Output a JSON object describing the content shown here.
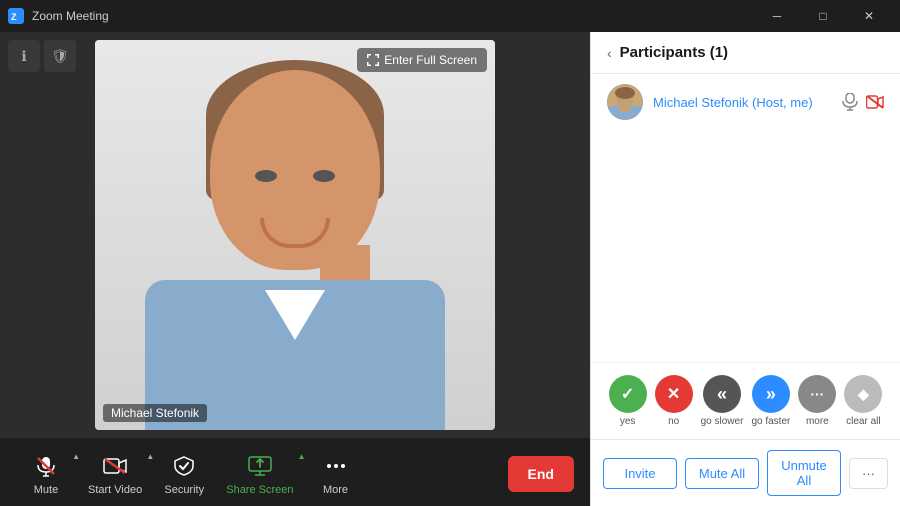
{
  "titleBar": {
    "appName": "Zoom Meeting",
    "minimizeIcon": "─",
    "maximizeIcon": "□",
    "closeIcon": "✕"
  },
  "topIcons": {
    "infoIcon": "ℹ",
    "shieldIcon": "🛡"
  },
  "videoArea": {
    "fullscreenBtn": "Enter Full Screen",
    "participantName": "Michael Stefonik"
  },
  "toolbar": {
    "muteLabel": "Mute",
    "startVideoLabel": "Start Video",
    "securityLabel": "Security",
    "shareScreenLabel": "Share Screen",
    "moreLabel": "More",
    "endLabel": "End"
  },
  "participants": {
    "panelTitle": "Participants (1)",
    "count": 1,
    "items": [
      {
        "name": "Michael Stefonik",
        "badge": "(Host, me)",
        "micMuted": false,
        "videoMuted": true
      }
    ]
  },
  "reactions": {
    "items": [
      {
        "label": "yes",
        "symbol": "✓",
        "class": "reaction-yes"
      },
      {
        "label": "no",
        "symbol": "✕",
        "class": "reaction-no"
      },
      {
        "label": "go slower",
        "symbol": "«",
        "class": "reaction-slower"
      },
      {
        "label": "go faster",
        "symbol": "»",
        "class": "reaction-faster"
      },
      {
        "label": "more",
        "symbol": "•••",
        "class": "reaction-more"
      },
      {
        "label": "clear all",
        "symbol": "◆",
        "class": "reaction-clear"
      }
    ]
  },
  "panelActions": {
    "inviteLabel": "Invite",
    "muteAllLabel": "Mute All",
    "unmuteAllLabel": "Unmute All",
    "moreLabel": "···"
  }
}
